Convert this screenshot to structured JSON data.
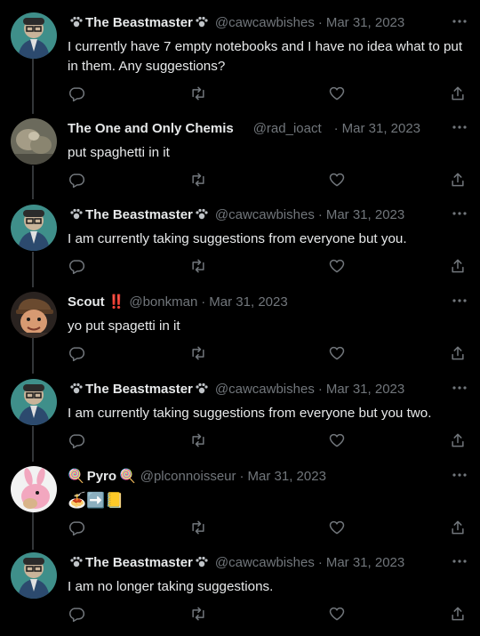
{
  "tweets": [
    {
      "name": "The Beastmaster",
      "handle": "@cawcawbishes",
      "date": "Mar 31, 2023",
      "text": "I currently have 7 empty notebooks and I have no idea what to put in them. Any suggestions?",
      "avatar": "beastmaster-avatar"
    },
    {
      "name": "The One and Only Chemis",
      "handle": "@rad_ioact",
      "date": "Mar 31, 2023",
      "text": "put spaghetti in it",
      "avatar": "chemis-avatar"
    },
    {
      "name": "The Beastmaster",
      "handle": "@cawcawbishes",
      "date": "Mar 31, 2023",
      "text": "I am currently taking suggestions from everyone but you.",
      "avatar": "beastmaster-avatar"
    },
    {
      "name": "Scout",
      "name_suffix": "‼️",
      "handle": "@bonkman",
      "date": "Mar 31, 2023",
      "text": "yo put spagetti in it",
      "avatar": "scout-avatar"
    },
    {
      "name": "The Beastmaster",
      "handle": "@cawcawbishes",
      "date": "Mar 31, 2023",
      "text": "I am currently taking suggestions from everyone but you two.",
      "avatar": "beastmaster-avatar"
    },
    {
      "name": "Pyro",
      "name_prefix": "🍭",
      "name_suffix": "🍭",
      "handle": "@plconnoisseur",
      "date": "Mar 31, 2023",
      "text": "🍝➡️📒",
      "avatar": "pyro-avatar"
    },
    {
      "name": "The Beastmaster",
      "handle": "@cawcawbishes",
      "date": "Mar 31, 2023",
      "text": "I am no longer taking suggestions.",
      "avatar": "beastmaster-avatar"
    }
  ],
  "colors": {
    "background": "#000000",
    "text": "#e7e9ea",
    "muted": "#71767b",
    "rail": "#333639"
  },
  "icons": [
    "reply-icon",
    "retweet-icon",
    "like-icon",
    "share-icon",
    "more-icon",
    "paw-icon"
  ]
}
